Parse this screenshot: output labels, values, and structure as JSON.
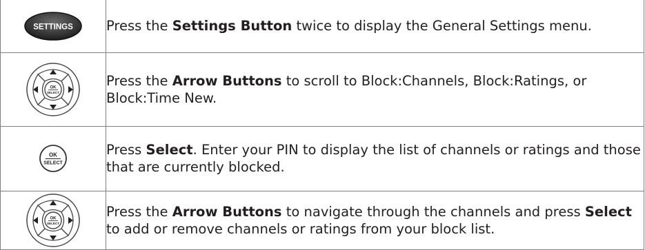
{
  "steps": [
    {
      "icon": "settings-button-icon",
      "icon_label": "SETTINGS",
      "text": [
        {
          "t": "Press the "
        },
        {
          "t": "Settings Button",
          "b": true
        },
        {
          "t": " twice to display the General Settings menu."
        }
      ]
    },
    {
      "icon": "arrow-buttons-icon",
      "icon_label": [
        "OK",
        "SELECT"
      ],
      "text": [
        {
          "t": "Press the "
        },
        {
          "t": "Arrow Buttons",
          "b": true
        },
        {
          "t": " to scroll to Block:Channels, Block:Ratings, or Block:Time New."
        }
      ]
    },
    {
      "icon": "select-button-icon",
      "icon_label": [
        "OK",
        "SELECT"
      ],
      "text": [
        {
          "t": "Press "
        },
        {
          "t": "Select",
          "b": true
        },
        {
          "t": ". Enter your PIN to display the list of channels or ratings and those that are currently blocked."
        }
      ]
    },
    {
      "icon": "arrow-buttons-icon",
      "icon_label": [
        "OK",
        "SELECT"
      ],
      "text": [
        {
          "t": "Press the "
        },
        {
          "t": "Arrow Buttons",
          "b": true
        },
        {
          "t": " to navigate through the channels and press "
        },
        {
          "t": "Select",
          "b": true
        },
        {
          "t": " to add or remove channels or ratings from your block list."
        }
      ]
    }
  ]
}
